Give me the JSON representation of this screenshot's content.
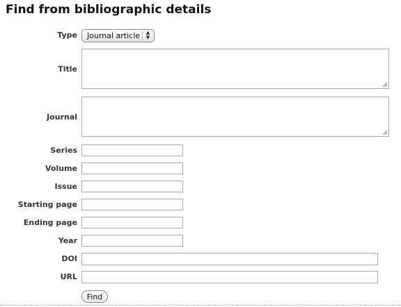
{
  "form": {
    "heading": "Find from bibliographic details",
    "type": {
      "label": "Type",
      "selected": "Journal article"
    },
    "title": {
      "label": "Title",
      "value": ""
    },
    "journal": {
      "label": "Journal",
      "value": ""
    },
    "series": {
      "label": "Series",
      "value": ""
    },
    "volume": {
      "label": "Volume",
      "value": ""
    },
    "issue": {
      "label": "Issue",
      "value": ""
    },
    "starting_page": {
      "label": "Starting page",
      "value": ""
    },
    "ending_page": {
      "label": "Ending page",
      "value": ""
    },
    "year": {
      "label": "Year",
      "value": ""
    },
    "doi": {
      "label": "DOI",
      "value": ""
    },
    "url": {
      "label": "URL",
      "value": ""
    },
    "find_button": "Find"
  },
  "icons": {
    "select_arrows": "up-down-chevron-icon",
    "resize_grip": "resize-grip-icon"
  }
}
